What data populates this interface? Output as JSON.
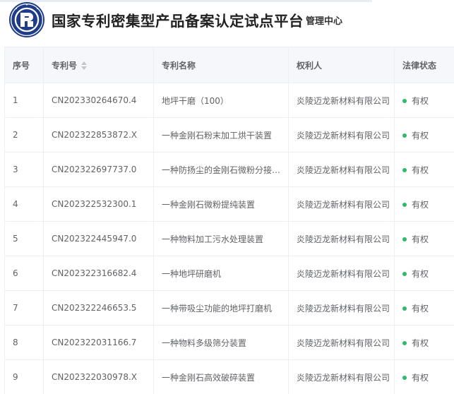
{
  "header": {
    "title": "国家专利密集型产品备案认定试点平台",
    "nav_label": "管理中心",
    "logo_icon": "platform-seal-logo"
  },
  "table": {
    "columns": [
      {
        "label": "序号"
      },
      {
        "label": "专利号",
        "sortable": true,
        "sort_icon": "sort-caret-icon"
      },
      {
        "label": "专利名称"
      },
      {
        "label": "权利人"
      },
      {
        "label": "法律状态"
      }
    ],
    "status_color": "#2dbb6a",
    "rows": [
      {
        "no": "1",
        "patent_no": "CN202330264670.4",
        "name": "地坪干磨（100）",
        "owner": "炎陵迈龙新材料有限公司",
        "status": "有权"
      },
      {
        "no": "2",
        "patent_no": "CN202322853872.X",
        "name": "一种金刚石粉末加工烘干装置",
        "owner": "炎陵迈龙新材料有限公司",
        "status": "有权"
      },
      {
        "no": "3",
        "patent_no": "CN202322697737.0",
        "name": "一种防扬尘的金刚石微粉分接装置",
        "owner": "炎陵迈龙新材料有限公司",
        "status": "有权"
      },
      {
        "no": "4",
        "patent_no": "CN202322532300.1",
        "name": "一种金刚石微粉提纯装置",
        "owner": "炎陵迈龙新材料有限公司",
        "status": "有权"
      },
      {
        "no": "5",
        "patent_no": "CN202322445947.0",
        "name": "一种物料加工污水处理装置",
        "owner": "炎陵迈龙新材料有限公司",
        "status": "有权"
      },
      {
        "no": "6",
        "patent_no": "CN202322316682.4",
        "name": "一种地坪研磨机",
        "owner": "炎陵迈龙新材料有限公司",
        "status": "有权"
      },
      {
        "no": "7",
        "patent_no": "CN202322246653.5",
        "name": "一种带吸尘功能的地坪打磨机",
        "owner": "炎陵迈龙新材料有限公司",
        "status": "有权"
      },
      {
        "no": "8",
        "patent_no": "CN202322031166.7",
        "name": "一种物料多级筛分装置",
        "owner": "炎陵迈龙新材料有限公司",
        "status": "有权"
      },
      {
        "no": "9",
        "patent_no": "CN202322030978.X",
        "name": "一种金刚石高效破碎装置",
        "owner": "炎陵迈龙新材料有限公司",
        "status": "有权"
      }
    ]
  }
}
